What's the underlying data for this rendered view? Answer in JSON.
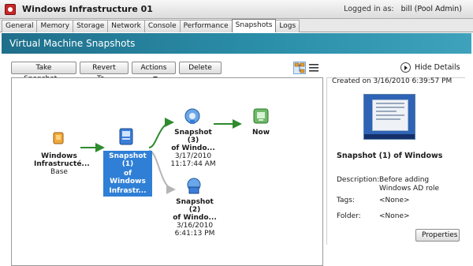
{
  "window": {
    "title": "Windows Infrastructure 01",
    "logged_in_label": "Logged in as:",
    "logged_in_user": "bill (Pool Admin)"
  },
  "tabs": [
    {
      "label": "General"
    },
    {
      "label": "Memory"
    },
    {
      "label": "Storage"
    },
    {
      "label": "Network"
    },
    {
      "label": "Console"
    },
    {
      "label": "Performance"
    },
    {
      "label": "Snapshots",
      "active": true
    },
    {
      "label": "Logs"
    }
  ],
  "section": {
    "title": "Virtual Machine Snapshots"
  },
  "toolbar": {
    "take_snapshot": "Take Snapshot...",
    "revert_to": "Revert To...",
    "actions": "Actions",
    "delete": "Delete",
    "hide_details": "Hide Details"
  },
  "tree": {
    "base": {
      "line1": "Windows",
      "line2": "Infrastructé...",
      "sub": "Base"
    },
    "snap1": {
      "line1": "Snapshot (1)",
      "line2": "of Windows",
      "line3": "Infrastr..."
    },
    "snap3": {
      "line1": "Snapshot (3)",
      "line2": "of Windo...",
      "date": "3/17/2010",
      "time": "11:17:44 AM"
    },
    "now": {
      "line1": "Now"
    },
    "snap2": {
      "line1": "Snapshot (2)",
      "line2": "of Windo...",
      "date": "3/16/2010",
      "time": "6:41:13 PM"
    }
  },
  "details": {
    "created": "Created on 3/16/2010 6:39:57 PM",
    "name": "Snapshot (1) of Windows",
    "description_label": "Description:",
    "description_value": "Before adding Windows AD role",
    "tags_label": "Tags:",
    "tags_value": "<None>",
    "folder_label": "Folder:",
    "folder_value": "<None>",
    "properties": "Properties"
  },
  "colors": {
    "header_teal": "#2b8ea9",
    "selection_blue": "#2f7fd6",
    "active_arrow_green": "#2e8b2e",
    "inactive_arrow_gray": "#b5b5b5"
  }
}
